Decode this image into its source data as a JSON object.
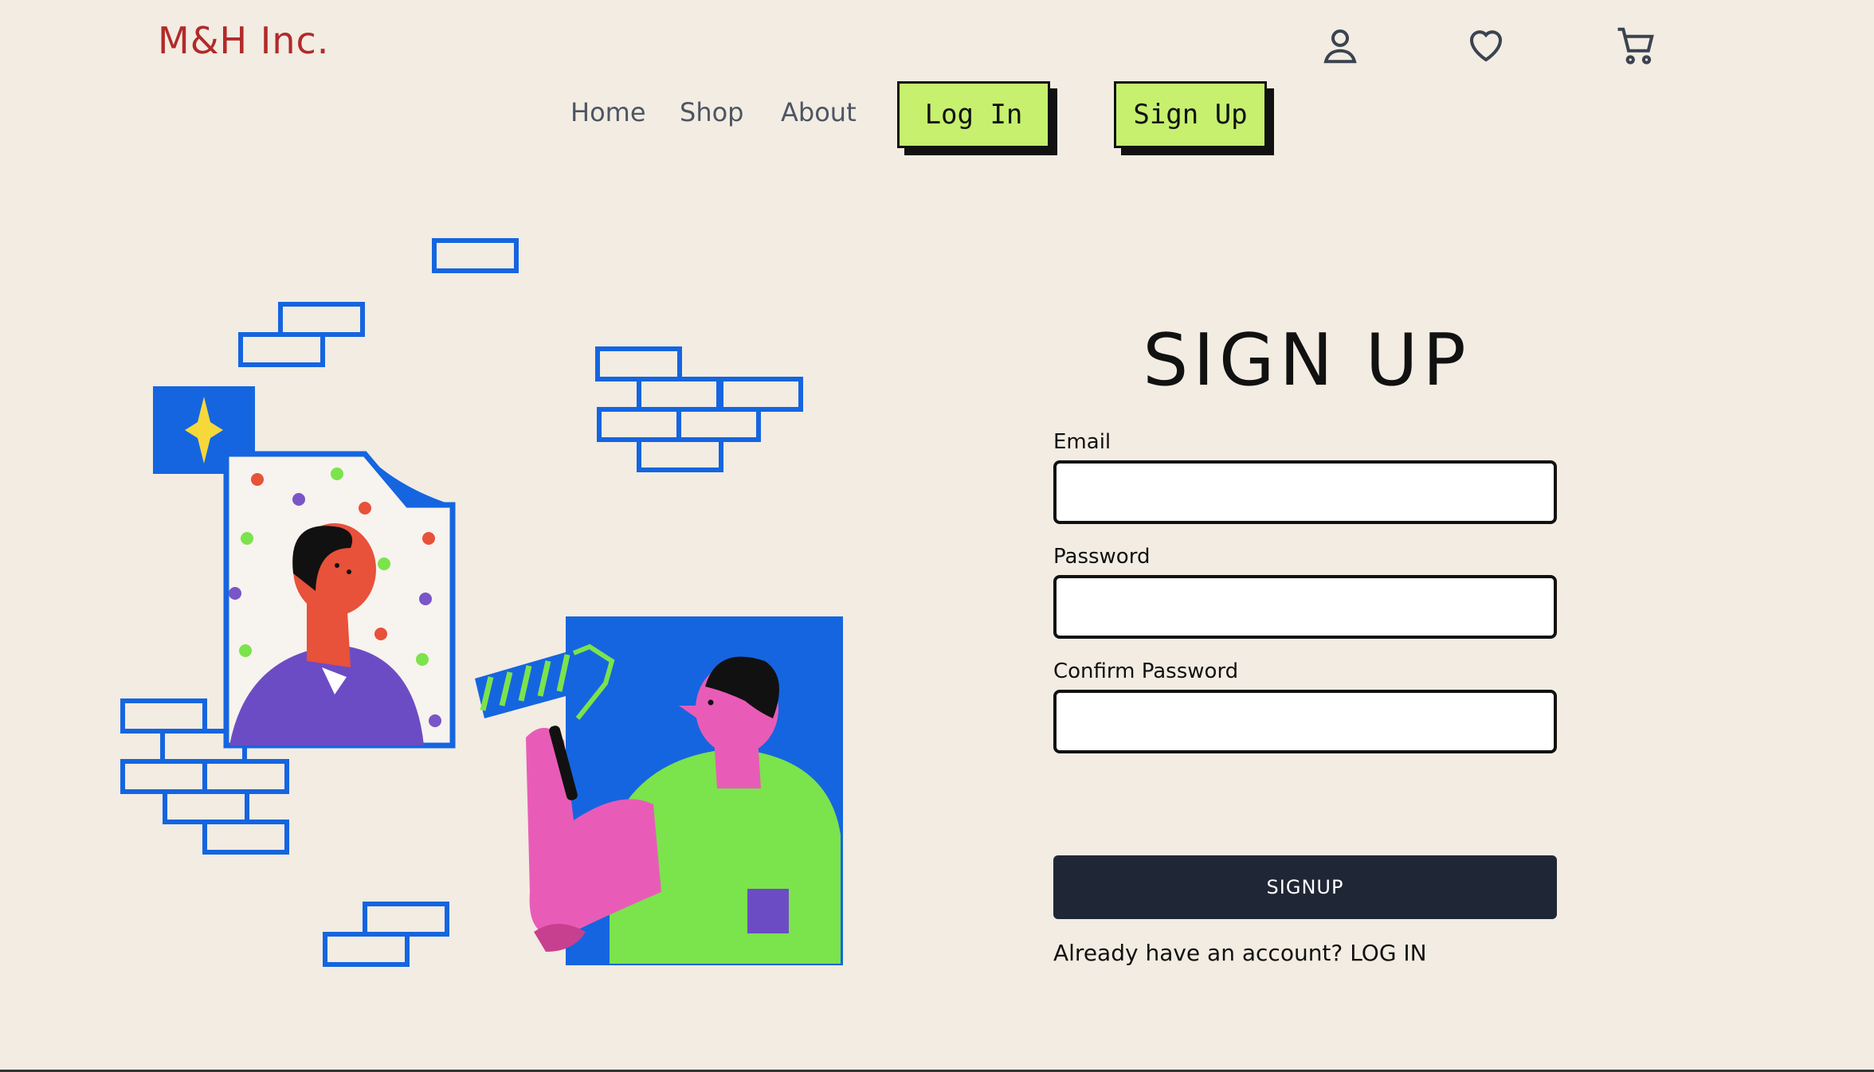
{
  "header": {
    "brand": "M&H Inc.",
    "icons": [
      "user-icon",
      "heart-icon",
      "cart-icon"
    ],
    "nav": {
      "home": "Home",
      "shop": "Shop",
      "about": "About"
    },
    "login_button": "Log In",
    "signup_button": "Sign Up"
  },
  "form": {
    "title": "SIGN UP",
    "email_label": "Email",
    "email_value": "",
    "password_label": "Password",
    "password_value": "",
    "confirm_label": "Confirm Password",
    "confirm_value": "",
    "submit_label": "SIGNUP",
    "footer_text": "Already have an account?",
    "footer_link": "LOG IN"
  },
  "colors": {
    "background": "#f2ece2",
    "brand": "#b22a2a",
    "cta": "#c6f06e",
    "submit": "#1f2736",
    "illustration_blue": "#1565e0"
  }
}
